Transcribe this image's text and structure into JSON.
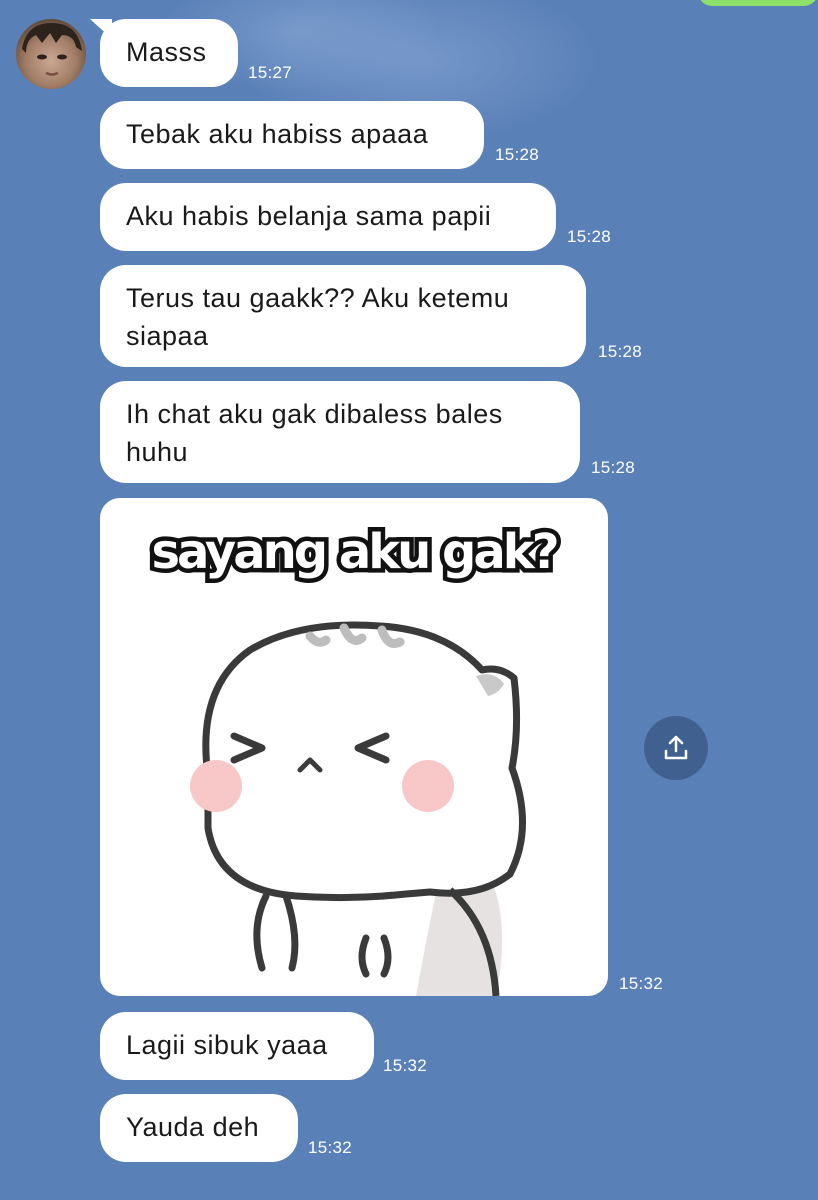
{
  "chat": {
    "contact_avatar": "avatar",
    "messages": [
      {
        "text": "Masss",
        "time": "15:27"
      },
      {
        "text": "Tebak aku habiss apaaa",
        "time": "15:28"
      },
      {
        "text": "Aku habis belanja sama papii",
        "time": "15:28"
      },
      {
        "text": "Terus tau gaakk?? Aku ketemu siapaa",
        "time": "15:28"
      },
      {
        "text": "Ih chat aku gak dibaless bales huhu",
        "time": "15:28"
      },
      {
        "sticker_caption": "sayang aku gak?",
        "time": "15:32",
        "sticker_icon": "crying-cat-sticker"
      },
      {
        "text": "Lagii sibuk yaaa",
        "time": "15:32"
      },
      {
        "text": "Yauda deh",
        "time": "15:32"
      }
    ],
    "share_icon": "share-upload-icon"
  }
}
